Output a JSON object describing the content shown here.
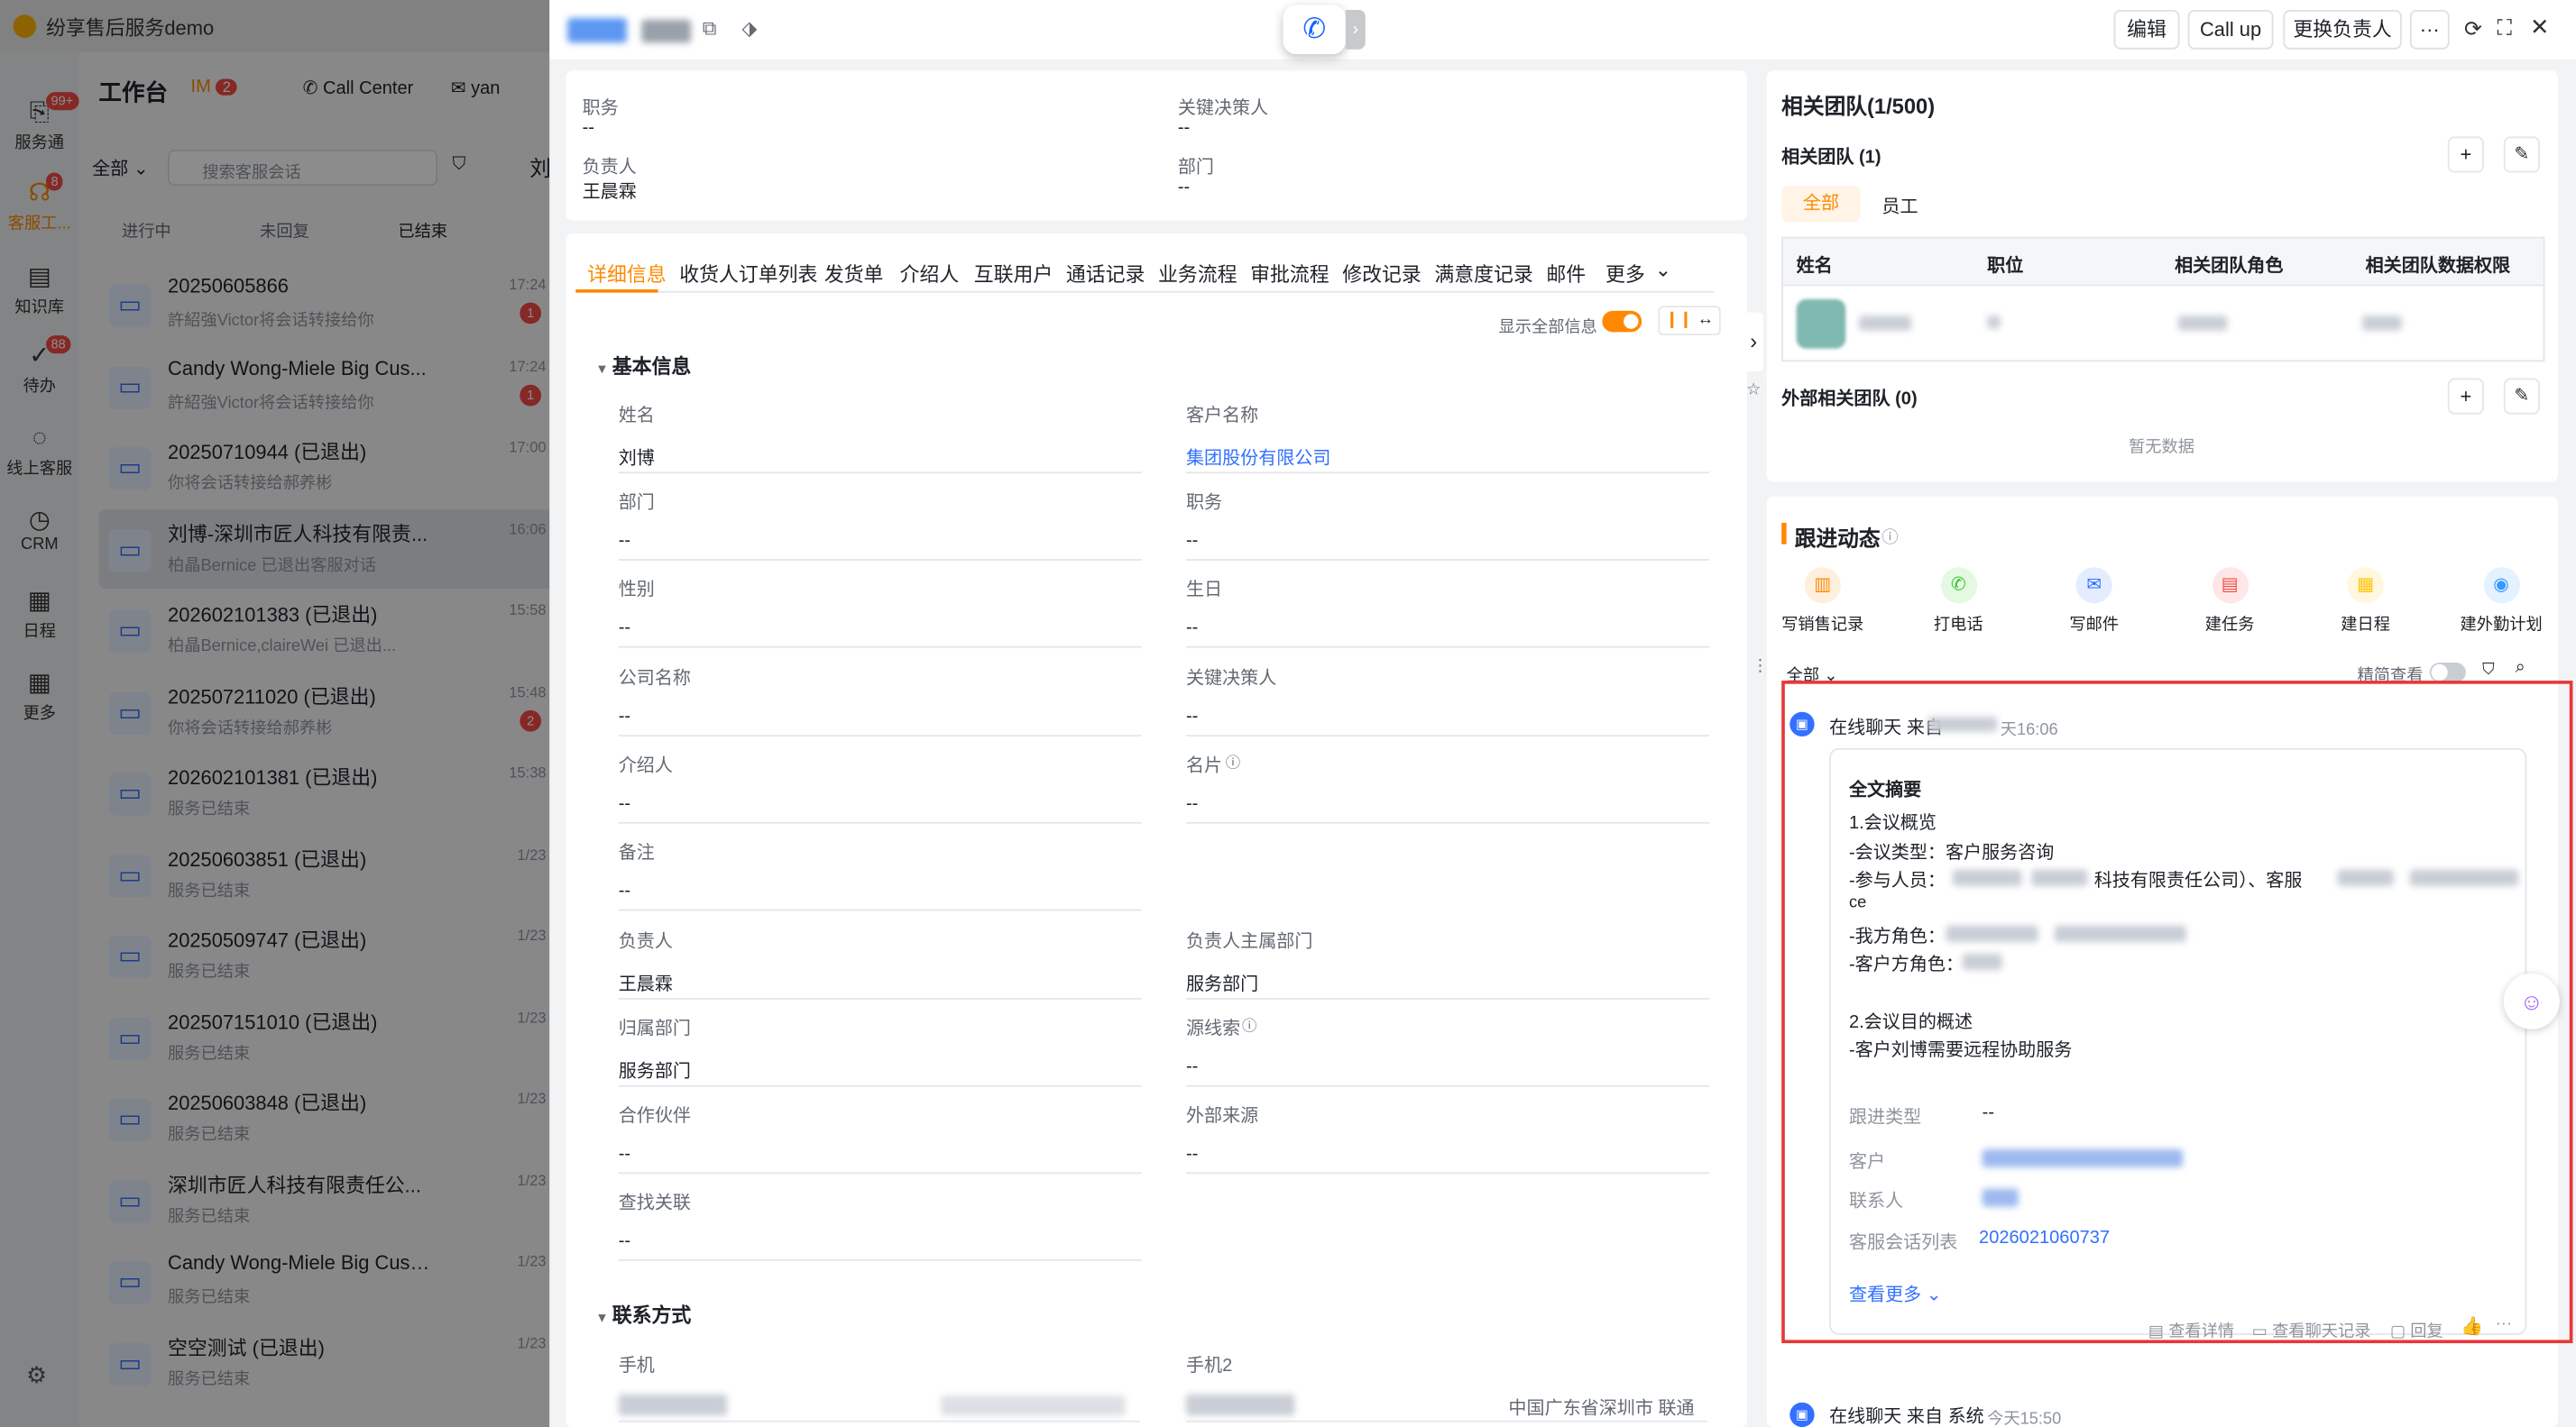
{
  "app": {
    "title": "纷享售后服务demo"
  },
  "rail": [
    {
      "icon": "service-icon",
      "label": "服务通",
      "badge": "99+"
    },
    {
      "icon": "headset-icon",
      "label": "客服工...",
      "badge": "8"
    },
    {
      "icon": "book-icon",
      "label": "知识库"
    },
    {
      "icon": "todo-icon",
      "label": "待办",
      "badge": "88"
    },
    {
      "icon": "chat-icon",
      "label": "线上客服"
    },
    {
      "icon": "crm-icon",
      "label": "CRM"
    },
    {
      "icon": "calendar-icon",
      "label": "日程"
    },
    {
      "icon": "grid-icon",
      "label": "更多"
    }
  ],
  "workspace": {
    "title": "工作台",
    "im_label": "IM",
    "im_badge": "2",
    "callcenter": "Call Center",
    "user": "yan",
    "filter_all": "全部",
    "search_placeholder": "搜索客服会话",
    "tabs": [
      "进行中",
      "未回复",
      "已结束"
    ],
    "side_name": "刘",
    "conversations": [
      {
        "title": "20250605866",
        "sub": "許紹強Victor将会话转接给你",
        "time": "17:24",
        "badge": "1"
      },
      {
        "title": "Candy Wong-Miele Big Cus...",
        "sub": "許紹強Victor将会话转接给你",
        "time": "17:24",
        "badge": "1"
      },
      {
        "title": "20250710944 (已退出)",
        "sub": "你将会话转接给郝养彬",
        "time": "17:00",
        "badge": ""
      },
      {
        "title": "刘博-深圳市匠人科技有限责...",
        "sub": "柏晶Bernice 已退出客服对话",
        "time": "16:06",
        "badge": "",
        "active": true
      },
      {
        "title": "202602101383 (已退出)",
        "sub": "柏晶Bernice,claireWei 已退出...",
        "time": "15:58",
        "badge": ""
      },
      {
        "title": "202507211020 (已退出)",
        "sub": "你将会话转接给郝养彬",
        "time": "15:48",
        "badge": "2"
      },
      {
        "title": "202602101381 (已退出)",
        "sub": "服务已结束",
        "time": "15:38",
        "badge": ""
      },
      {
        "title": "20250603851 (已退出)",
        "sub": "服务已结束",
        "time": "1/23",
        "badge": ""
      },
      {
        "title": "20250509747 (已退出)",
        "sub": "服务已结束",
        "time": "1/23",
        "badge": ""
      },
      {
        "title": "202507151010 (已退出)",
        "sub": "服务已结束",
        "time": "1/23",
        "badge": ""
      },
      {
        "title": "20250603848 (已退出)",
        "sub": "服务已结束",
        "time": "1/23",
        "badge": ""
      },
      {
        "title": "深圳市匠人科技有限责任公...",
        "sub": "服务已结束",
        "time": "1/23",
        "badge": ""
      },
      {
        "title": "Candy Wong-Miele Big Cust...",
        "sub": "服务已结束",
        "time": "1/23",
        "badge": ""
      },
      {
        "title": "空空测试 (已退出)",
        "sub": "服务已结束",
        "time": "1/23",
        "badge": ""
      }
    ]
  },
  "header": {
    "edit": "编辑",
    "callup": "Call up",
    "change_owner": "更换负责人",
    "more": "···"
  },
  "summary": {
    "position_label": "职务",
    "position_value": "--",
    "decision_label": "关键决策人",
    "decision_value": "--",
    "owner_label": "负责人",
    "owner_value": "王晨霖",
    "dept_label": "部门",
    "dept_value": "--"
  },
  "tabs": [
    "详细信息",
    "收货人订单列表",
    "发货单",
    "介绍人",
    "互联用户",
    "通话记录",
    "业务流程",
    "审批流程",
    "修改记录",
    "满意度记录",
    "邮件",
    "更多"
  ],
  "show_all_label": "显示全部信息",
  "basic": {
    "title": "基本信息",
    "fields": [
      {
        "label": "姓名",
        "value": "刘博"
      },
      {
        "label": "客户名称",
        "value": "集团股份有限公司",
        "link": true
      },
      {
        "label": "部门",
        "value": "--"
      },
      {
        "label": "职务",
        "value": "--"
      },
      {
        "label": "性别",
        "value": "--"
      },
      {
        "label": "生日",
        "value": "--"
      },
      {
        "label": "公司名称",
        "value": "--"
      },
      {
        "label": "关键决策人",
        "value": "--"
      },
      {
        "label": "介绍人",
        "value": "--"
      },
      {
        "label": "名片",
        "value": "--"
      },
      {
        "label": "备注",
        "value": "--"
      },
      {
        "label": "",
        "value": ""
      },
      {
        "label": "负责人",
        "value": "王晨霖"
      },
      {
        "label": "负责人主属部门",
        "value": "服务部门"
      },
      {
        "label": "归属部门",
        "value": "服务部门"
      },
      {
        "label": "源线索",
        "value": "--"
      },
      {
        "label": "合作伙伴",
        "value": "--"
      },
      {
        "label": "外部来源",
        "value": "--"
      },
      {
        "label": "查找关联",
        "value": "--"
      }
    ]
  },
  "contact": {
    "title": "联系方式",
    "phone_label": "手机",
    "phone2_label": "手机2",
    "phone2_location": "中国广东省深圳市 联通"
  },
  "team": {
    "title": "相关团队(1/500)",
    "sub_title": "相关团队 (1)",
    "filters": [
      "全部",
      "员工"
    ],
    "columns": [
      "姓名",
      "职位",
      "相关团队角色",
      "相关团队数据权限"
    ],
    "external_title": "外部相关团队 (0)",
    "empty": "暂无数据"
  },
  "followup": {
    "title": "跟进动态",
    "actions": [
      {
        "icon": "sales-record-icon",
        "label": "写销售记录",
        "color": "#ff8800"
      },
      {
        "icon": "phone-icon",
        "label": "打电话",
        "color": "#34c724"
      },
      {
        "icon": "mail-icon",
        "label": "写邮件",
        "color": "#3370ff"
      },
      {
        "icon": "task-icon",
        "label": "建任务",
        "color": "#f54a45"
      },
      {
        "icon": "schedule-icon",
        "label": "建日程",
        "color": "#ffc60a"
      },
      {
        "icon": "location-icon",
        "label": "建外勤计划",
        "color": "#3399ff"
      }
    ],
    "filter": "全部",
    "compact_label": "精简查看",
    "item": {
      "source": "在线聊天 来自",
      "time": "天16:06",
      "summary_title": "全文摘要",
      "lines": [
        "1.会议概览",
        "-会议类型：客户服务咨询",
        "-参与人员：",
        "科技有限责任公司）、客服",
        "ce",
        "-我方角色：",
        "-客户方角色：",
        "2.会议目的概述",
        "-客户刘博需要远程协助服务"
      ],
      "meta": {
        "type_label": "跟进类型",
        "type_value": "--",
        "customer_label": "客户",
        "contact_label": "联系人",
        "session_label": "客服会话列表",
        "session_value": "2026021060737"
      },
      "see_more": "查看更多",
      "footer": [
        "查看详情",
        "查看聊天记录",
        "回复",
        "···"
      ]
    },
    "item2": {
      "source": "在线聊天 来自 系统",
      "time": "今天15:50"
    }
  },
  "colors": {
    "accent": "#ff8800",
    "link": "#3370ff",
    "highlight_border": "#f54a45"
  }
}
